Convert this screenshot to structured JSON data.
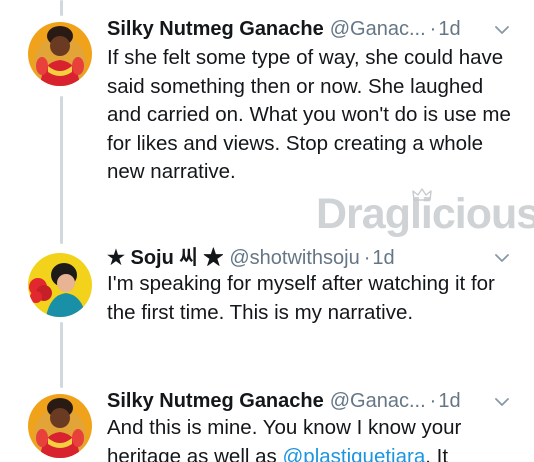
{
  "tweets": [
    {
      "display_name": "Silky Nutmeg Ganache",
      "handle": "@Ganac...",
      "separator": "·",
      "time": "1d",
      "text": "If she felt some type of way, she could have said something then or now. She laughed and carried on. What you won't do is use me for likes and views. Stop creating a whole new narrative."
    },
    {
      "display_name": "★ Soju 씨 ★",
      "handle": "@shotwithsoju",
      "separator": "·",
      "time": "1d",
      "text": "I'm speaking for myself after watching it for the first time. This is my narrative."
    },
    {
      "display_name": "Silky Nutmeg Ganache",
      "handle": "@Ganac...",
      "separator": "·",
      "time": "1d",
      "text_before_mention": "And this is mine. You know I know your heritage as well as ",
      "mention": "@plastiquetiara",
      "text_after_mention": ". It"
    }
  ],
  "watermark": {
    "text": "Draglicious"
  },
  "colors": {
    "text": "#14171a",
    "secondary": "#657786",
    "link": "#1b95e0",
    "thread_line": "#cfd9de",
    "watermark": "#d0d3d6"
  }
}
